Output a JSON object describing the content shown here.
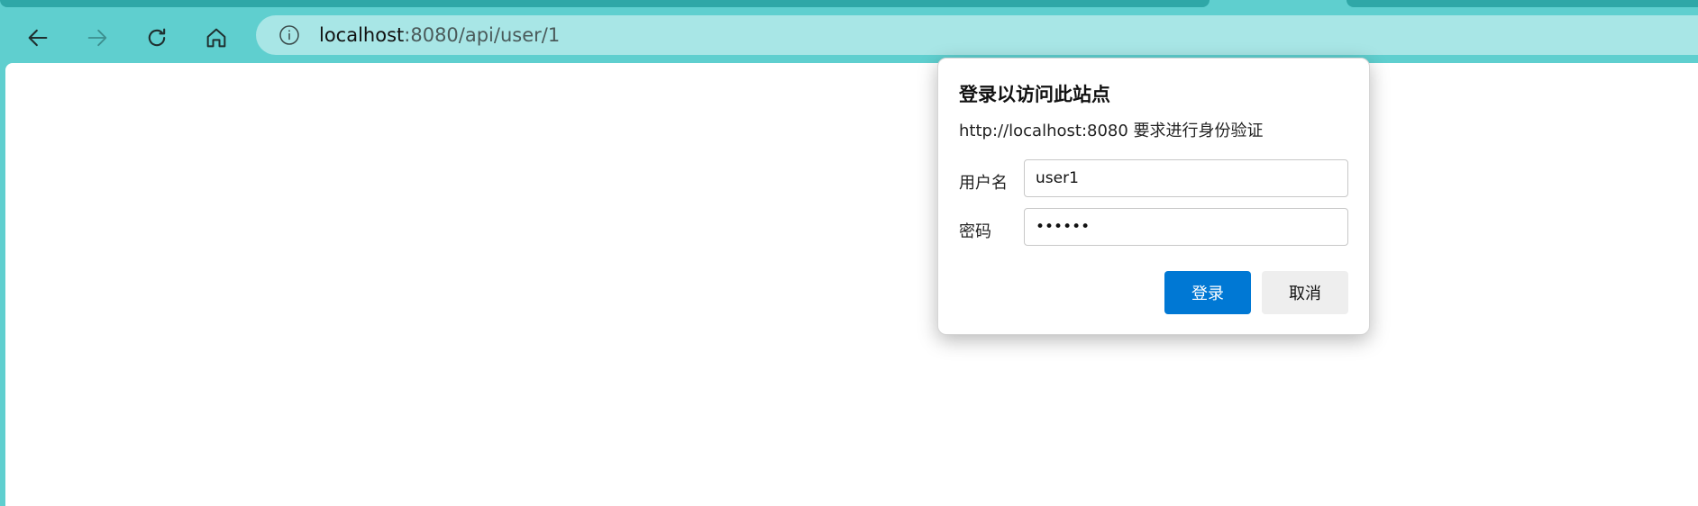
{
  "browser": {
    "address": {
      "host": "localhost",
      "rest": ":8080/api/user/1"
    }
  },
  "icons": {
    "back": "arrow-left",
    "forward": "arrow-right",
    "refresh": "refresh",
    "home": "home",
    "info": "info-circle"
  },
  "colors": {
    "frame": "#5fcfcf",
    "address_bar": "#a8e6e6",
    "primary_button": "#0078d4"
  },
  "dialog": {
    "title": "登录以访问此站点",
    "message": "http://localhost:8080 要求进行身份验证",
    "username_label": "用户名",
    "username_value": "user1",
    "password_label": "密码",
    "password_value": "••••••",
    "login_button": "登录",
    "cancel_button": "取消"
  }
}
